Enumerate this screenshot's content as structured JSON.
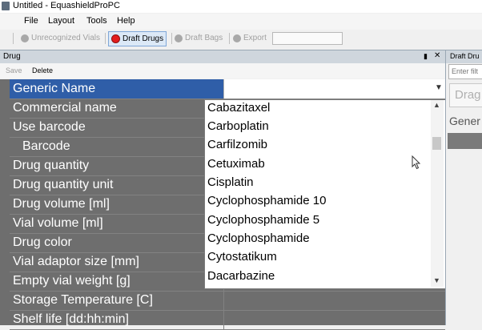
{
  "window": {
    "title": "Untitled - EquashieldProPC"
  },
  "menu": {
    "items": [
      "File",
      "Layout",
      "Tools",
      "Help"
    ]
  },
  "toolbar": {
    "unrecognized_vials": "Unrecognized Vials",
    "draft_drugs": "Draft Drugs",
    "draft_bags": "Draft Bags",
    "export": "Export",
    "active_color": "#e31d1d"
  },
  "drug_panel": {
    "title": "Drug",
    "pin_icon": "pin-icon",
    "close_icon": "close-icon",
    "save": "Save",
    "delete": "Delete",
    "fields": [
      "Generic Name",
      "Commercial name",
      "Use barcode",
      "Barcode",
      "Drug quantity",
      "Drug quantity unit",
      "Drug volume [ml]",
      "Vial volume [ml]",
      "Drug color",
      "Vial adaptor size [mm]",
      "Empty vial weight [g]",
      "Storage Temperature [C]",
      "Shelf life [dd:hh:min]"
    ],
    "selected_field_color": "#2f5ea8"
  },
  "generic_name_dropdown": {
    "options": [
      "Cabazitaxel",
      "Carboplatin",
      "Carfilzomib",
      "Cetuximab",
      "Cisplatin",
      "Cyclophosphamide 10",
      "Cyclophosphamide 5",
      "Cyclophosphamide",
      "Cytostatikum",
      "Dacarbazine"
    ]
  },
  "right_panel": {
    "title": "Draft Dru",
    "filter_placeholder": "Enter filt",
    "drag_hint": "Drag",
    "column": "Gener"
  }
}
